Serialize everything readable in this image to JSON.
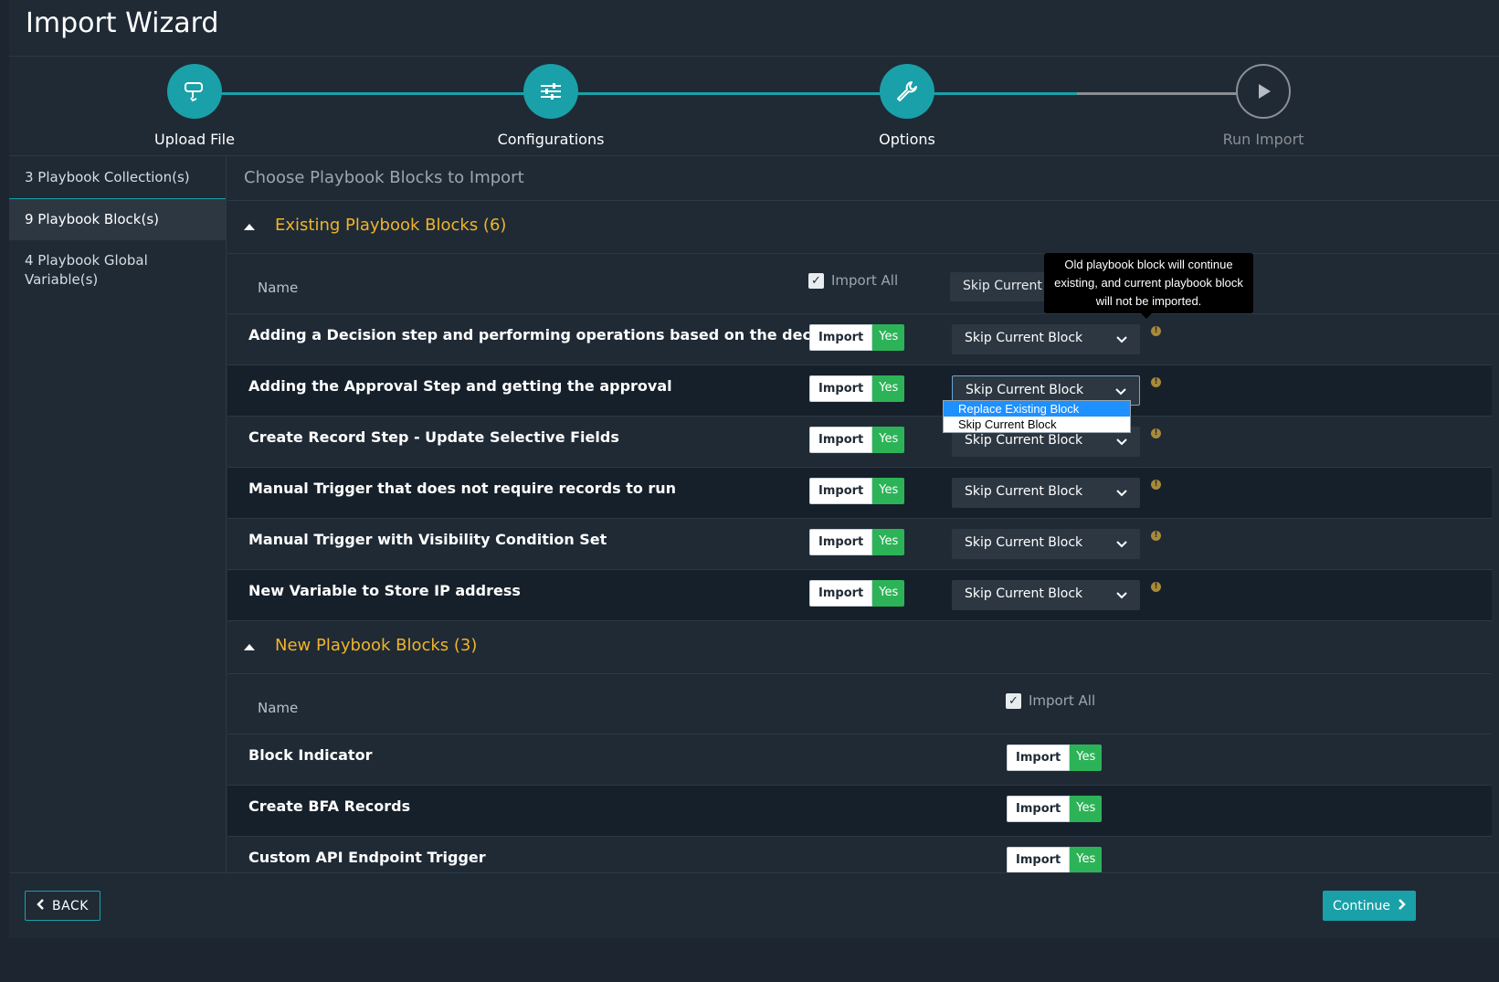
{
  "window": {
    "title": "Import Wizard"
  },
  "stepper": {
    "steps": [
      {
        "label": "Upload File",
        "icon": "upload-icon",
        "state": "complete"
      },
      {
        "label": "Configurations",
        "icon": "sliders-icon",
        "state": "complete"
      },
      {
        "label": "Options",
        "icon": "wrench-icon",
        "state": "active"
      },
      {
        "label": "Run Import",
        "icon": "play-icon",
        "state": "inactive"
      }
    ]
  },
  "sidebar": {
    "items": [
      {
        "label": "3 Playbook Collection(s)"
      },
      {
        "label": "9 Playbook Block(s)",
        "active": true
      },
      {
        "label": "4 Playbook Global Variable(s)"
      }
    ]
  },
  "main": {
    "header": "Choose Playbook Blocks to Import",
    "existing": {
      "title": "Existing Playbook Blocks (6)",
      "name_header": "Name",
      "import_all_label": "Import All",
      "head_select_value": "Skip Current b",
      "rows": [
        {
          "name": "Adding a Decision step and performing operations based on the decision",
          "import_label": "Import",
          "toggle": "Yes",
          "action": "Skip Current Block"
        },
        {
          "name": "Adding the Approval Step and getting the approval",
          "import_label": "Import",
          "toggle": "Yes",
          "action": "Skip Current Block"
        },
        {
          "name": "Create Record Step - Update Selective Fields",
          "import_label": "Import",
          "toggle": "Yes",
          "action": "Skip Current Block"
        },
        {
          "name": "Manual Trigger that does not require records to run",
          "import_label": "Import",
          "toggle": "Yes",
          "action": "Skip Current Block"
        },
        {
          "name": "Manual Trigger with Visibility Condition Set",
          "import_label": "Import",
          "toggle": "Yes",
          "action": "Skip Current Block"
        },
        {
          "name": "New Variable to Store IP address",
          "import_label": "Import",
          "toggle": "Yes",
          "action": "Skip Current Block"
        }
      ],
      "dropdown_options": [
        "Replace Existing Block",
        "Skip Current Block"
      ],
      "tooltip": "Old playbook block will continue existing, and current playbook block will not be imported."
    },
    "new": {
      "title": "New Playbook Blocks (3)",
      "name_header": "Name",
      "import_all_label": "Import All",
      "rows": [
        {
          "name": "Block Indicator",
          "import_label": "Import",
          "toggle": "Yes"
        },
        {
          "name": "Create BFA Records",
          "import_label": "Import",
          "toggle": "Yes"
        },
        {
          "name": "Custom API Endpoint Trigger",
          "import_label": "Import",
          "toggle": "Yes"
        }
      ]
    }
  },
  "footer": {
    "back_label": "BACK",
    "continue_label": "Continue"
  },
  "colors": {
    "accent": "#1aa0a8",
    "section_title": "#f0b429",
    "toggle_yes": "#2cb357",
    "highlight": "#1e90ff"
  }
}
